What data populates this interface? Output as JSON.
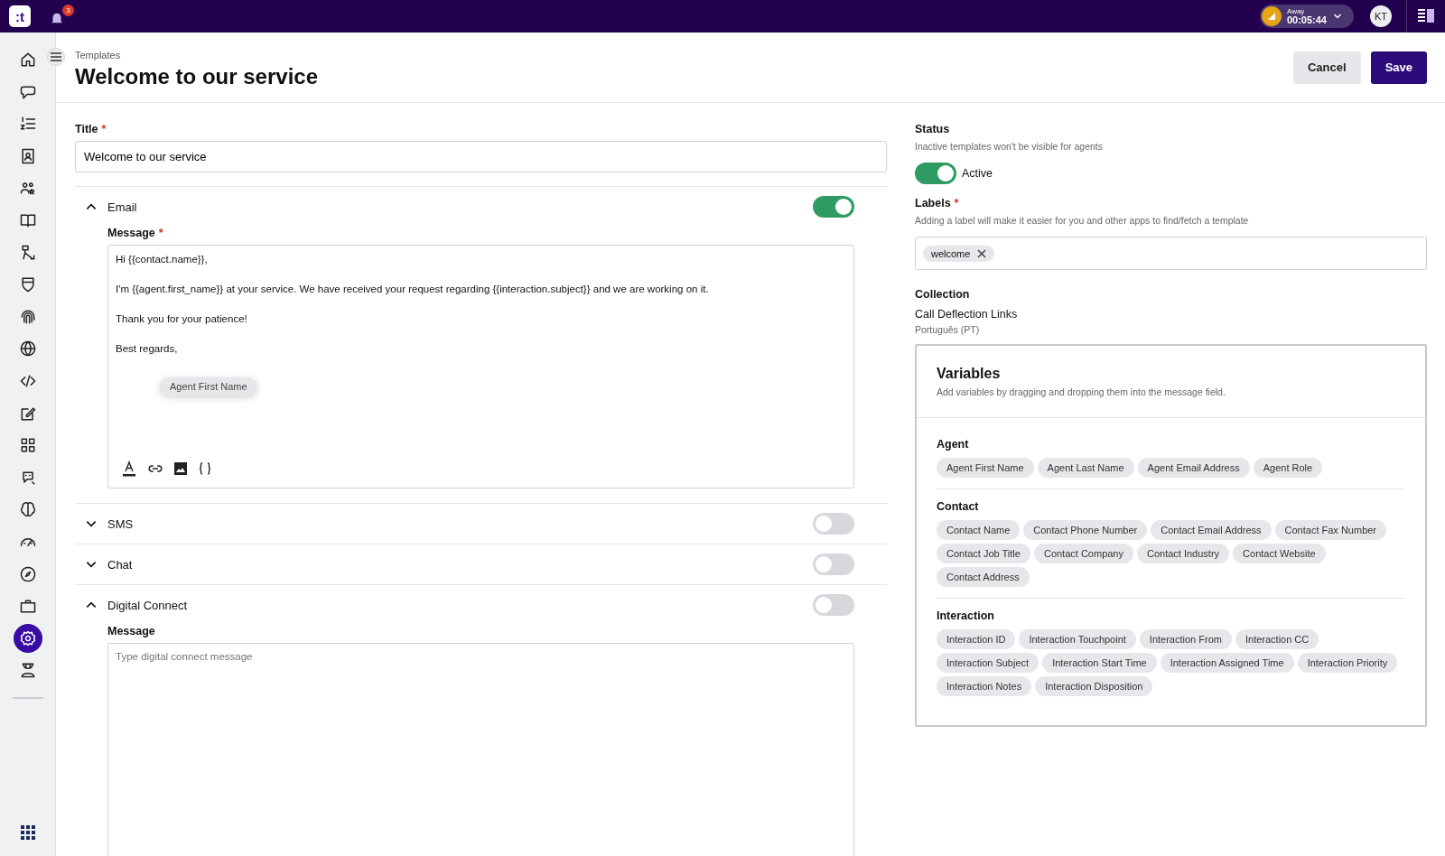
{
  "topbar": {
    "logo": ":t",
    "notifications": "3",
    "status": {
      "label": "Away",
      "timer": "00:05:44"
    },
    "avatar": "KT"
  },
  "sidebar": {
    "items": [
      {
        "selected": false
      },
      {
        "selected": false
      },
      {
        "selected": false
      },
      {
        "selected": false
      },
      {
        "selected": false
      },
      {
        "selected": false
      },
      {
        "selected": false
      },
      {
        "selected": false
      },
      {
        "selected": false
      },
      {
        "selected": false
      },
      {
        "selected": false
      },
      {
        "selected": false
      },
      {
        "selected": false
      },
      {
        "selected": false
      },
      {
        "selected": false
      },
      {
        "selected": false
      },
      {
        "selected": false
      },
      {
        "selected": false
      },
      {
        "selected": true
      },
      {
        "selected": false
      }
    ]
  },
  "header": {
    "breadcrumb": "Templates",
    "title": "Welcome to our service",
    "buttons": [
      {
        "label": "Cancel",
        "kind": "secondary"
      },
      {
        "label": "Save",
        "kind": "primary"
      }
    ]
  },
  "title_field": {
    "label": "Title",
    "required_mark": "*",
    "value": "Welcome to our service"
  },
  "channels": [
    {
      "name": "Email",
      "expanded": true,
      "on": true,
      "message": {
        "label": "Message",
        "required_mark": "*",
        "lines": [
          "Hi {{contact.name}},",
          "I'm {{agent.first_name}} at your service. We have received your request regarding {{interaction.subject}} and we are working on it.",
          "Thank you for your patience!",
          "Best regards,"
        ],
        "drag_chip": "Agent First Name"
      }
    },
    {
      "name": "SMS",
      "expanded": false,
      "on": false
    },
    {
      "name": "Chat",
      "expanded": false,
      "on": false
    },
    {
      "name": "Digital Connect",
      "expanded": true,
      "on": false,
      "message": {
        "label": "Message",
        "placeholder": "Type digital connect message"
      }
    }
  ],
  "status": {
    "label": "Status",
    "hint": "Inactive templates won't be visible for agents",
    "on": true,
    "value": "Active"
  },
  "labels": {
    "label": "Labels",
    "required_mark": "*",
    "hint": "Adding a label will make it easier for you and other apps to find/fetch a template",
    "tags": [
      "welcome"
    ]
  },
  "collection": {
    "label": "Collection",
    "name": "Call Deflection Links",
    "language": "Português (PT)"
  },
  "variables": {
    "title": "Variables",
    "hint": "Add variables by dragging and dropping them into the message field.",
    "groups": [
      {
        "name": "Agent",
        "items": [
          "Agent First Name",
          "Agent Last Name",
          "Agent Email Address",
          "Agent Role"
        ]
      },
      {
        "name": "Contact",
        "items": [
          "Contact Name",
          "Contact Phone Number",
          "Contact Email Address",
          "Contact Fax Number",
          "Contact Job Title",
          "Contact Company",
          "Contact Industry",
          "Contact Website",
          "Contact Address"
        ]
      },
      {
        "name": "Interaction",
        "items": [
          "Interaction ID",
          "Interaction Touchpoint",
          "Interaction From",
          "Interaction CC",
          "Interaction Subject",
          "Interaction Start Time",
          "Interaction Assigned Time",
          "Interaction Priority",
          "Interaction Notes",
          "Interaction Disposition"
        ]
      }
    ]
  }
}
